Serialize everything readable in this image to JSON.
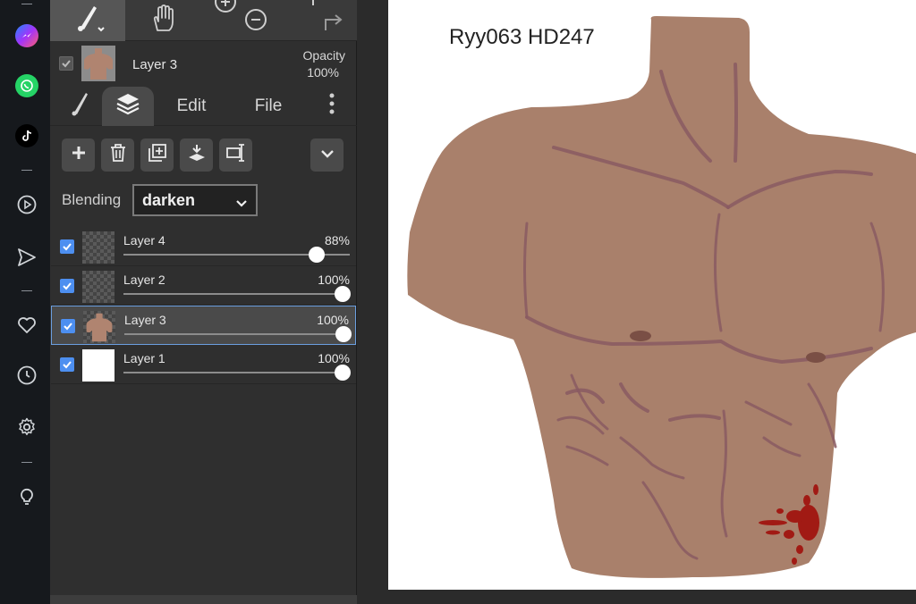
{
  "tools": {
    "brush": "brush-icon",
    "hand": "hand-icon",
    "zoom_in": "zoom-in-icon",
    "zoom_out": "zoom-out-icon",
    "undo": "undo-icon",
    "redo": "redo-icon"
  },
  "current_layer": {
    "name": "Layer 3",
    "opacity_label": "Opacity",
    "opacity_value": "100%"
  },
  "tabs": {
    "edit": "Edit",
    "file": "File"
  },
  "blending": {
    "label": "Blending",
    "value": "darken"
  },
  "layers": [
    {
      "name": "Layer 4",
      "opacity": "88%",
      "level": 0.88,
      "visible": true,
      "selected": false,
      "thumb": "transparent"
    },
    {
      "name": "Layer 2",
      "opacity": "100%",
      "level": 1.0,
      "visible": true,
      "selected": false,
      "thumb": "transparent"
    },
    {
      "name": "Layer 3",
      "opacity": "100%",
      "level": 1.0,
      "visible": true,
      "selected": true,
      "thumb": "torso"
    },
    {
      "name": "Layer 1",
      "opacity": "100%",
      "level": 1.0,
      "visible": true,
      "selected": false,
      "thumb": "white"
    }
  ],
  "canvas": {
    "caption": "Ryy063 HD247",
    "skin_color": "#a9806b",
    "line_color": "#8a5a62",
    "blood_color": "#a11a14"
  },
  "colors": {
    "accent": "#4d8ff0",
    "dock_bg": "#16191d"
  }
}
